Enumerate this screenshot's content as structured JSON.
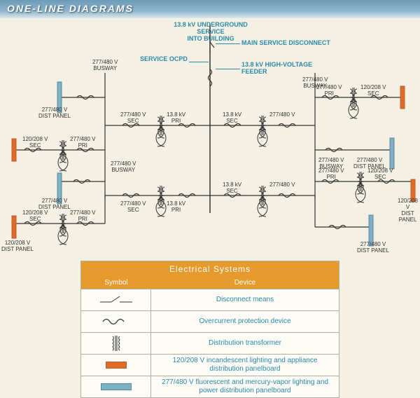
{
  "header": {
    "title": "ONE-LINE DIAGRAMS"
  },
  "callouts": {
    "service_top": "13.8 kV UNDERGROUND SERVICE\nINTO BUILDING",
    "main_disc": "MAIN SERVICE DISCONNECT",
    "service_ocpd": "SERVICE OCPD",
    "hv_feeder": "13.8 kV HIGH-VOLTAGE\nFEEDER"
  },
  "labels": {
    "busway_277_480": "277/480 V\nBUSWAY",
    "dist_277_480": "277/480 V\nDIST PANEL",
    "dist_120_208": "120/208 V\nDIST PANEL",
    "pri_277_480": "277/480 V\nPRI",
    "sec_277_480": "277/480 V\nSEC",
    "sec_120_208": "120/208 V\nSEC",
    "pri_138": "13.8 kV\nPRI",
    "sec_138": "13.8 kV\nSEC",
    "v277_480": "277/480 V"
  },
  "legend": {
    "title": "Electrical Systems",
    "col_symbol": "Symbol",
    "col_device": "Device",
    "rows": [
      {
        "device": "Disconnect means"
      },
      {
        "device": "Overcurrent protection device"
      },
      {
        "device": "Distribution transformer"
      },
      {
        "device": "120/208 V incandescent lighting and appliance distribution panelboard"
      },
      {
        "device": "277/480 V fluorescent and mercury-vapor lighting and power distribution panelboard"
      }
    ]
  }
}
